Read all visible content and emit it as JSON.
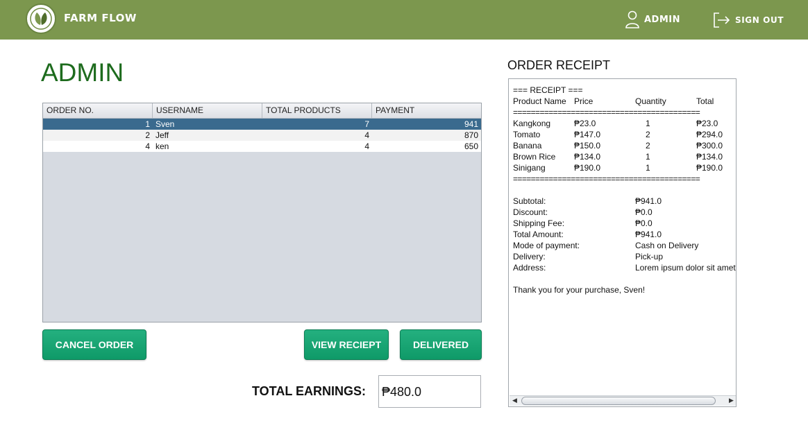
{
  "header": {
    "brand": "FARM FLOW",
    "admin_label": "ADMIN",
    "signout_label": "SIGN OUT",
    "colors": {
      "bar": "#7c974e"
    }
  },
  "page": {
    "title": "ADMIN"
  },
  "orders_table": {
    "columns": [
      "ORDER NO.",
      "USERNAME",
      "TOTAL PRODUCTS",
      "PAYMENT"
    ],
    "rows": [
      {
        "order_no": "1",
        "username": "Sven",
        "total_products": "7",
        "payment": "941",
        "selected": true
      },
      {
        "order_no": "2",
        "username": "Jeff",
        "total_products": "4",
        "payment": "870",
        "selected": false
      },
      {
        "order_no": "4",
        "username": "ken",
        "total_products": "4",
        "payment": "650",
        "selected": false
      }
    ]
  },
  "buttons": {
    "cancel": "CANCEL ORDER",
    "view_receipt": "VIEW RECIEPT",
    "delivered": "DELIVERED"
  },
  "earnings": {
    "label": "TOTAL EARNINGS:",
    "value": "₱480.0"
  },
  "receipt": {
    "title": "ORDER RECEIPT",
    "heading": "=== RECEIPT ===",
    "col_headers": {
      "name": "Product Name",
      "price": "Price",
      "quantity": "Quantity",
      "total": "Total"
    },
    "separator": "==========================================",
    "items": [
      {
        "name": "Kangkong",
        "price": "₱23.0",
        "quantity": "1",
        "total": "₱23.0"
      },
      {
        "name": "Tomato",
        "price": "₱147.0",
        "quantity": "2",
        "total": "₱294.0"
      },
      {
        "name": "Banana",
        "price": "₱150.0",
        "quantity": "2",
        "total": "₱300.0"
      },
      {
        "name": "Brown Rice",
        "price": "₱134.0",
        "quantity": "1",
        "total": "₱134.0"
      },
      {
        "name": "Sinigang",
        "price": "₱190.0",
        "quantity": "1",
        "total": "₱190.0"
      }
    ],
    "summary": [
      {
        "label": "Subtotal:",
        "value": "₱941.0"
      },
      {
        "label": "Discount:",
        "value": "₱0.0"
      },
      {
        "label": "Shipping Fee:",
        "value": "₱0.0"
      },
      {
        "label": "Total Amount:",
        "value": "₱941.0"
      },
      {
        "label": "Mode of payment:",
        "value": "Cash on Delivery"
      },
      {
        "label": "Delivery:",
        "value": "Pick-up"
      },
      {
        "label": "Address:",
        "value": "Lorem ipsum dolor sit amet"
      }
    ],
    "thanks": "Thank you for your purchase, Sven!"
  }
}
